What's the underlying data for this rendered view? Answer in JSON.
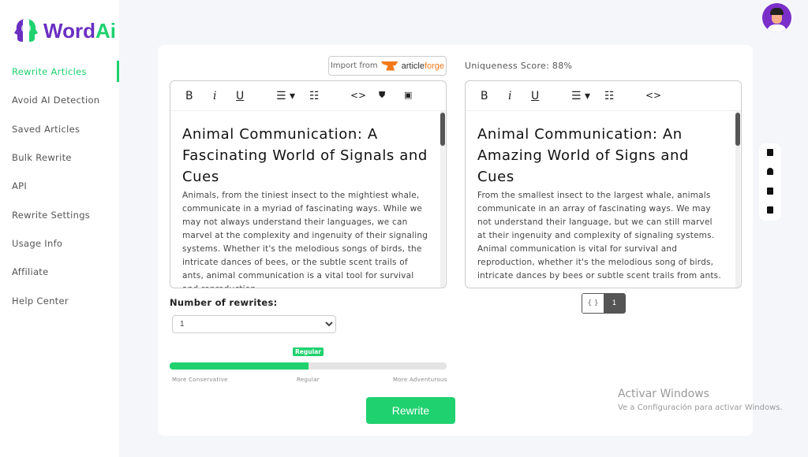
{
  "brand": {
    "name_a": "Word",
    "name_b": "Ai"
  },
  "sidebar": {
    "items": [
      {
        "label": "Rewrite Articles",
        "active": true
      },
      {
        "label": "Avoid AI Detection"
      },
      {
        "label": "Saved Articles"
      },
      {
        "label": "Bulk Rewrite"
      },
      {
        "label": "API"
      },
      {
        "label": "Rewrite Settings"
      },
      {
        "label": "Usage Info"
      },
      {
        "label": "Affiliate"
      },
      {
        "label": "Help Center"
      }
    ]
  },
  "import": {
    "label": "Import from",
    "brand_a": "article",
    "brand_b": "forge"
  },
  "uniqueness": "Uniqueness Score: 88%",
  "toolbar": {
    "bold": "B",
    "italic": "i",
    "underline": "U",
    "code": "<>"
  },
  "input": {
    "title": "Animal Communication: A Fascinating World of Signals and Cues",
    "body": "Animals, from the tiniest insect to the mightiest whale, communicate in a myriad of fascinating ways. While we may not always understand their languages, we can marvel at the complexity and ingenuity of their signaling systems. Whether it's the melodious songs of birds, the intricate dances of bees, or the subtle scent trails of ants, animal communication is a vital tool for survival and reproduction."
  },
  "output": {
    "title": "Animal Communication: An Amazing World of Signs and Cues",
    "body": "From the smallest insect to the largest whale, animals communicate in an array of fascinating ways. We may not understand their language, but we can still marvel at their ingenuity and complexity of signaling systems. Animal communication is vital for survival and reproduction, whether it's the melodious song of birds, intricate dances by bees or subtle scent trails from ants."
  },
  "rewrites": {
    "label": "Number of rewrites:",
    "value": "1"
  },
  "slider": {
    "value_label": "Regular",
    "level_percent": 50,
    "min_label": "More Conservative",
    "mid_label": "Regular",
    "max_label": "More Adventurous"
  },
  "rewrite_button": "Rewrite",
  "pager": {
    "json": "{ }",
    "page": "1"
  },
  "watermark": {
    "title": "Activar Windows",
    "sub": "Ve a Configuración para activar Windows."
  },
  "colors": {
    "accent": "#1fd16f",
    "brand": "#6a2fc2"
  }
}
